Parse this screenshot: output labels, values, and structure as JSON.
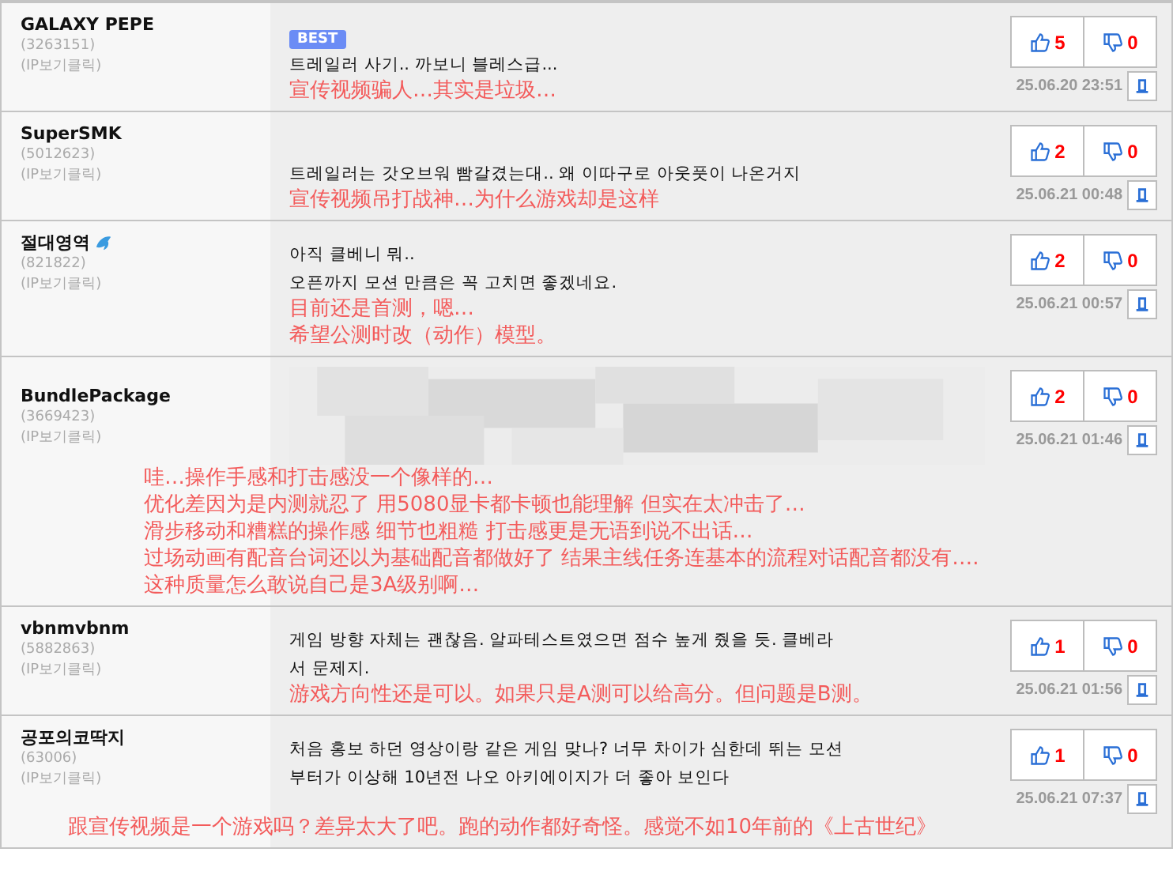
{
  "comments": [
    {
      "user": "GALAXY PEPE",
      "user_id": "(3263151)",
      "ip_link": "(IP보기클릭)",
      "user_icon": false,
      "badge": "BEST",
      "text": [
        "트레일러 사기.. 까보니 블레스급..."
      ],
      "translation": [
        "宣传视频骗人…其实是垃圾…"
      ],
      "up": "5",
      "down": "0",
      "date": "25.06.20 23:51"
    },
    {
      "user": "SuperSMK",
      "user_id": "(5012623)",
      "ip_link": "(IP보기클릭)",
      "user_icon": false,
      "text": [
        "트레일러는 갓오브워 빰갈겼는대.. 왜 이따구로 아웃풋이 나온거지"
      ],
      "translation": [
        "宣传视频吊打战神…为什么游戏却是这样"
      ],
      "up": "2",
      "down": "0",
      "date": "25.06.21 00:48"
    },
    {
      "user": "절대영역",
      "user_id": "(821822)",
      "ip_link": "(IP보기클릭)",
      "user_icon": true,
      "text": [
        "아직 클베니 뭐..",
        "오픈까지 모션 만큼은 꼭 고치면 좋겠네요."
      ],
      "translation": [
        "目前还是首测，嗯…",
        "希望公测时改（动作）模型。"
      ],
      "up": "2",
      "down": "0",
      "date": "25.06.21 00:57"
    },
    {
      "user": "BundlePackage",
      "user_id": "(3669423)",
      "ip_link": "(IP보기클릭)",
      "user_icon": false,
      "media": {
        "kind": "picture"
      },
      "translation": [
        "哇…操作手感和打击感没一个像样的…",
        "优化差因为是内测就忍了 用5080显卡都卡顿也能理解 但实在太冲击了…",
        "滑步移动和糟糕的操作感 细节也粗糙 打击感更是无语到说不出话…",
        "过场动画有配音台词还以为基础配音都做好了 结果主线任务连基本的流程对话配音都没有….",
        "这种质量怎么敢说自己是3A级别啊…"
      ],
      "up": "2",
      "down": "0",
      "date": "25.06.21 01:46"
    },
    {
      "user": "vbnmvbnm",
      "user_id": "(5882863)",
      "ip_link": "(IP보기클릭)",
      "user_icon": false,
      "text": [
        "게임 방향 자체는 괜찮음. 알파테스트였으면 점수 높게 줬을 듯. 클베라",
        "서 문제지."
      ],
      "translation": [
        "游戏方向性还是可以。如果只是A测可以给高分。但问题是B测。"
      ],
      "up": "1",
      "down": "0",
      "date": "25.06.21 01:56"
    },
    {
      "user": "공포의코딱지",
      "user_id": "(63006)",
      "ip_link": "(IP보기클릭)",
      "user_icon": false,
      "text": [
        "처음 홍보 하던 영상이랑 같은 게임 맞나? 너무 차이가 심한데 뛰는 모션",
        "부터가 이상해 10년전 나오 아키에이지가 더 좋아 보인다"
      ],
      "translation": [
        "跟宣传视频是一个游戏吗？差异太大了吧。跑的动作都好奇怪。感觉不如10年前的《上古世纪》"
      ],
      "up": "1",
      "down": "0",
      "date": "25.06.21 07:37"
    }
  ]
}
